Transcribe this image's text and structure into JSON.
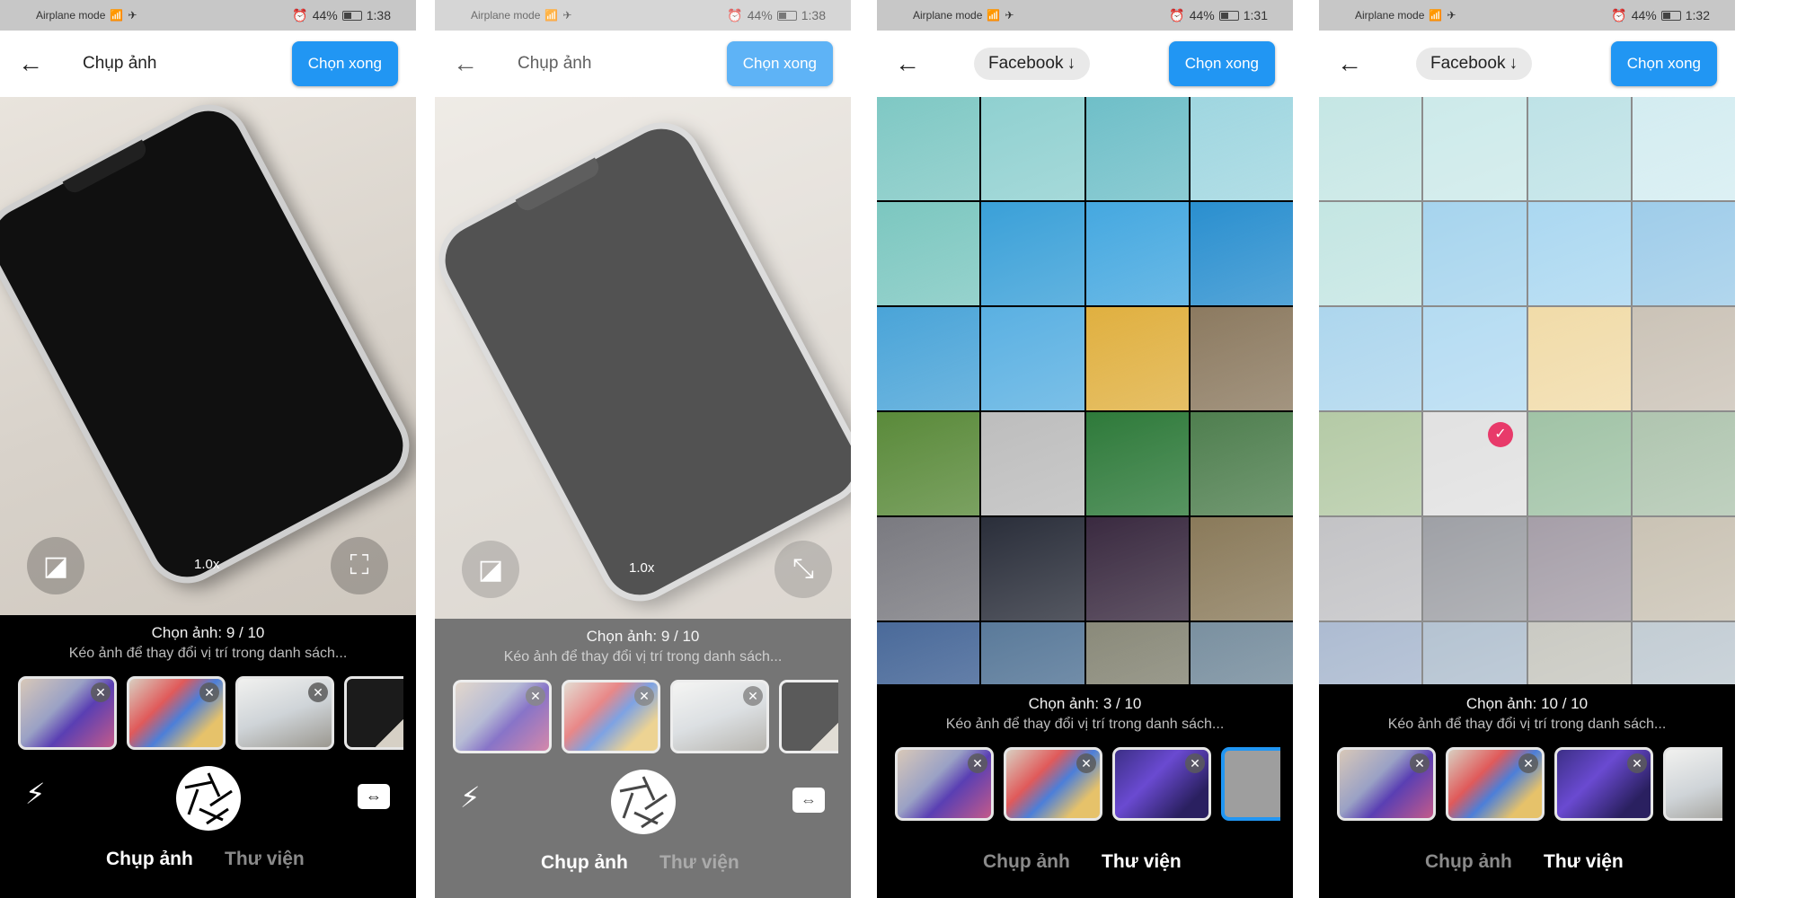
{
  "status_bar": {
    "left": "Airplane mode",
    "battery": "44%",
    "times": [
      "1:38",
      "1:38",
      "1:31",
      "1:32"
    ]
  },
  "header": {
    "camera_title": "Chụp ảnh",
    "album_name": "Facebook",
    "album_arrow": "↓",
    "done_label": "Chọn xong",
    "back_icon": "arrow-left-icon"
  },
  "camera": {
    "zoom": "1.0x"
  },
  "selection": {
    "counts": [
      "Chọn ảnh: 9 / 10",
      "Chọn ảnh: 9 / 10",
      "Chọn ảnh: 3 / 10",
      "Chọn ảnh: 10 / 10"
    ],
    "hint": "Kéo ảnh để thay đổi vị trí trong danh sách..."
  },
  "tabs": {
    "camera": "Chụp ảnh",
    "library": "Thư viện"
  },
  "colors": {
    "accent": "#2196f3",
    "check_badge": "#e83a6a",
    "panel": "#000000"
  },
  "gallery_colors": [
    "#7fc8c4",
    "#8fd0d0",
    "#6fbfc8",
    "#9fd6e0",
    "#7cc7c0",
    "#3aa0d8",
    "#45a8e0",
    "#2a8fcf",
    "#4aa4d8",
    "#5ab0e2",
    "#e0b040",
    "#8c7a60",
    "#5a8a3a",
    "#bdbdbd",
    "#2e7a3a",
    "#4f7f4f",
    "#7a7a80",
    "#2a2e3a",
    "#3a2a40",
    "#8a7a5a",
    "#4a6a9a",
    "#5a7a9a",
    "#8a8a7a",
    "#7a90a0"
  ]
}
